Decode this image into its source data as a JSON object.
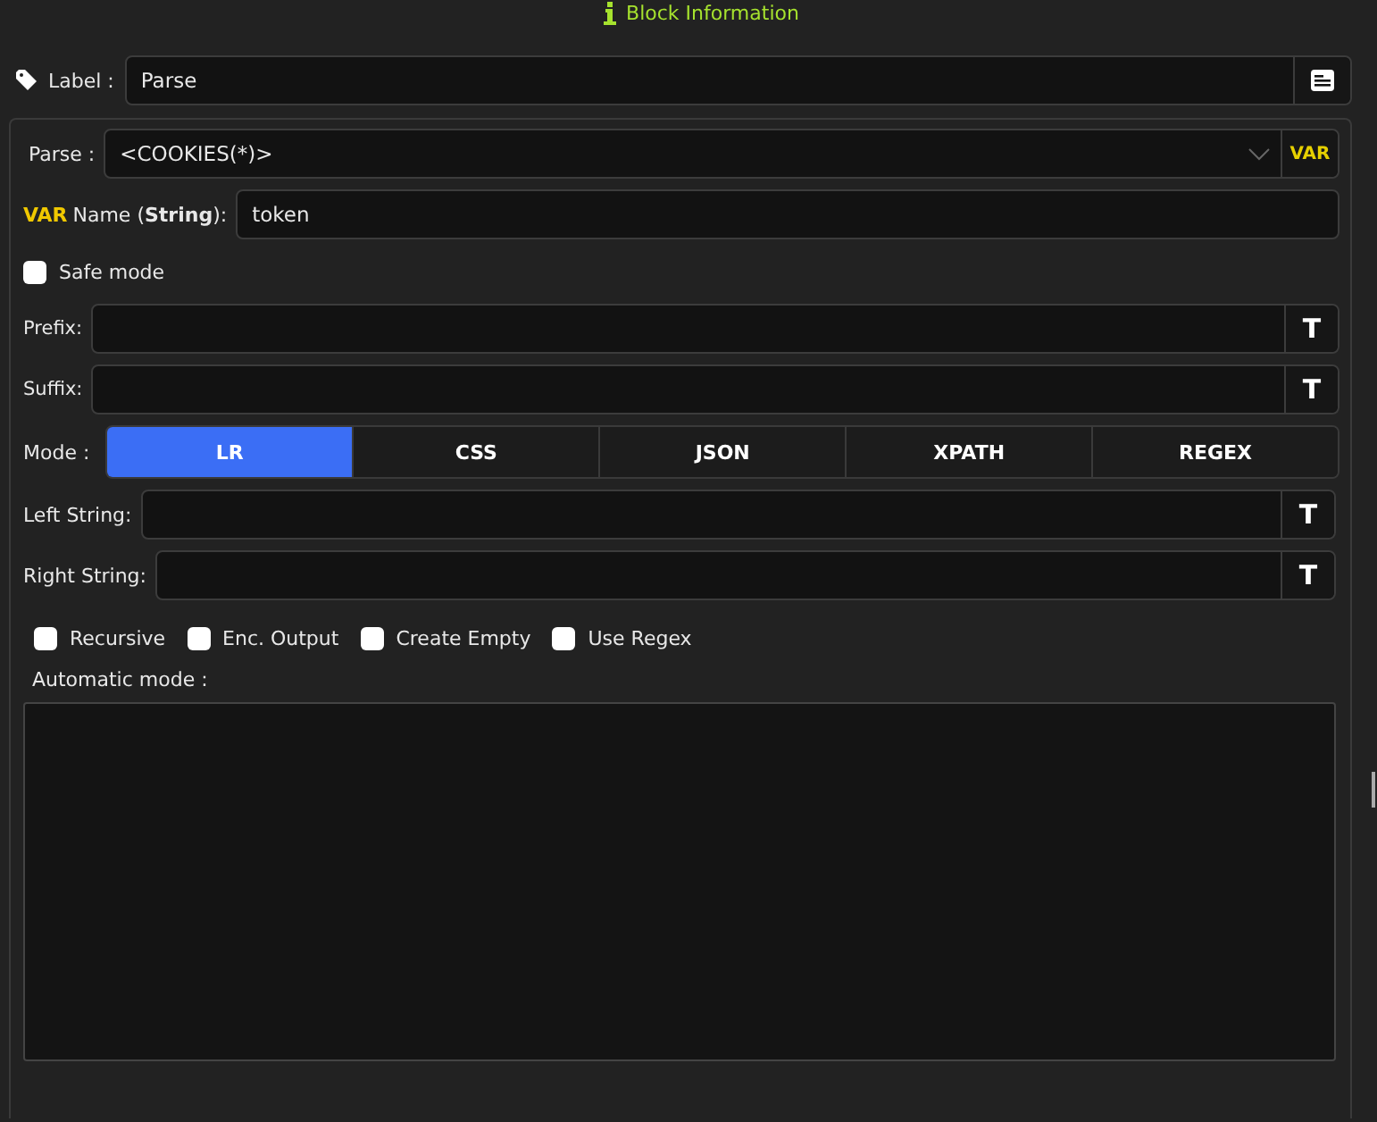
{
  "header": {
    "title": "Block Information"
  },
  "label_row": {
    "label": "Label :",
    "value": "Parse"
  },
  "parse": {
    "label": "Parse :",
    "value": "<COOKIES(*)>",
    "var_button": "VAR"
  },
  "var_name": {
    "tag": "VAR",
    "label": "Name (**String**):",
    "value": "token"
  },
  "safe_mode": {
    "label": "Safe mode",
    "checked": false
  },
  "prefix": {
    "label": "Prefix:",
    "button": "T"
  },
  "suffix": {
    "label": "Suffix:",
    "button": "T"
  },
  "mode": {
    "label": "Mode :",
    "tabs": [
      {
        "label": "LR",
        "selected": true
      },
      {
        "label": "CSS",
        "selected": false
      },
      {
        "label": "JSON",
        "selected": false
      },
      {
        "label": "XPATH",
        "selected": false
      },
      {
        "label": "REGEX",
        "selected": false
      }
    ]
  },
  "left_string": {
    "label": "Left String:",
    "button": "T"
  },
  "right_string": {
    "label": "Right String:",
    "button": "T"
  },
  "options": [
    {
      "label": "Recursive",
      "checked": false
    },
    {
      "label": "Enc. Output",
      "checked": false
    },
    {
      "label": "Create Empty",
      "checked": false
    },
    {
      "label": "Use Regex",
      "checked": false
    }
  ],
  "automatic_mode": {
    "label": "Automatic mode :"
  }
}
